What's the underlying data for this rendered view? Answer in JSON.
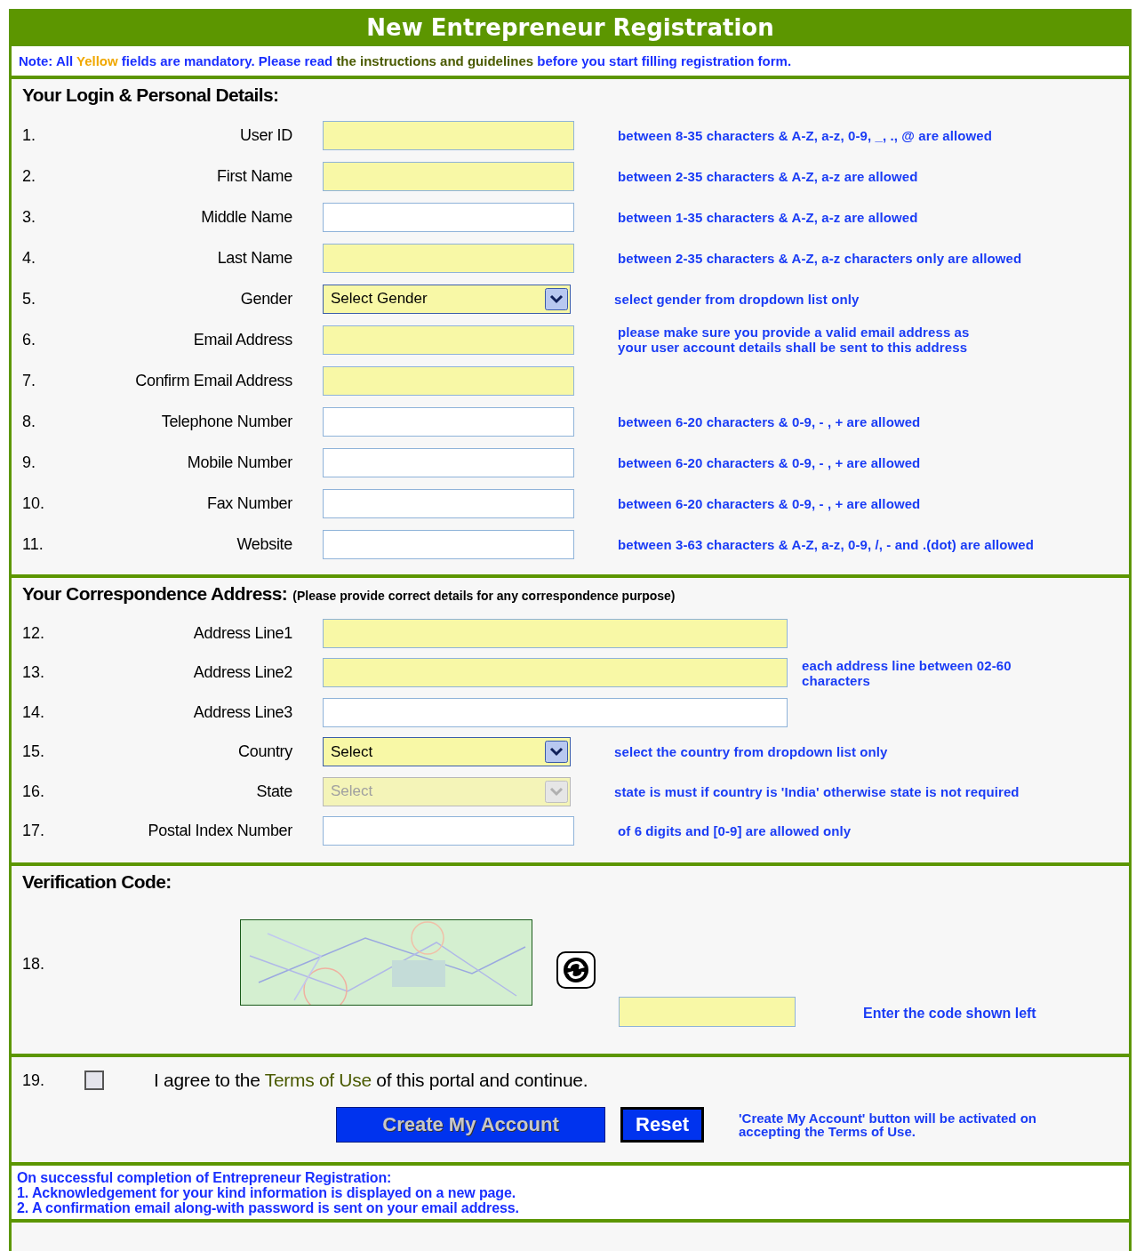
{
  "title": "New Entrepreneur Registration",
  "note": [
    {
      "kind": "plain",
      "text": "Note: All "
    },
    {
      "kind": "yellow",
      "text": "Yellow"
    },
    {
      "kind": "plain",
      "text": " fields are mandatory. Please read "
    },
    {
      "kind": "link",
      "text": "the instructions and guidelines"
    },
    {
      "kind": "plain",
      "text": " before you start filling registration form."
    }
  ],
  "personal": {
    "heading": "Your Login & Personal Details:",
    "rows": [
      {
        "number": "1.",
        "label": "User ID",
        "kind": "text",
        "required": true,
        "hint_lines": [
          "between 8-35 characters & A-Z, a-z, 0-9, _, ., @ are allowed"
        ]
      },
      {
        "number": "2.",
        "label": "First Name",
        "kind": "text",
        "required": true,
        "hint_lines": [
          "between 2-35 characters & A-Z, a-z are allowed"
        ]
      },
      {
        "number": "3.",
        "label": "Middle Name",
        "kind": "text",
        "required": false,
        "hint_lines": [
          "between 1-35 characters & A-Z, a-z are allowed"
        ]
      },
      {
        "number": "4.",
        "label": "Last Name",
        "kind": "text",
        "required": true,
        "hint_lines": [
          "between 2-35 characters & A-Z, a-z characters only are allowed"
        ]
      },
      {
        "number": "5.",
        "label": "Gender",
        "kind": "select",
        "required": true,
        "disabled": false,
        "value": "Select Gender",
        "hint_lines": [
          "select gender from dropdown list only"
        ]
      },
      {
        "number": "6.",
        "label": "Email Address",
        "kind": "text",
        "required": true,
        "hint_lines": [
          "please make sure you provide a valid email address as",
          "your user account details shall be sent to this address"
        ]
      },
      {
        "number": "7.",
        "label": "Confirm Email Address",
        "kind": "text",
        "required": true
      },
      {
        "number": "8.",
        "label": "Telephone Number",
        "kind": "text",
        "required": false,
        "hint_lines": [
          "between 6-20 characters & 0-9, - , +  are allowed"
        ]
      },
      {
        "number": "9.",
        "label": "Mobile Number",
        "kind": "text",
        "required": false,
        "hint_lines": [
          "between 6-20 characters & 0-9, - , +  are allowed"
        ]
      },
      {
        "number": "10.",
        "label": "Fax Number",
        "kind": "text",
        "required": false,
        "hint_lines": [
          "between 6-20 characters & 0-9, - , +  are allowed"
        ]
      },
      {
        "number": "11.",
        "label": "Website",
        "kind": "text",
        "required": false,
        "hint_lines": [
          "between 3-63 characters & A-Z, a-z, 0-9, /, - and .(dot) are allowed"
        ]
      }
    ]
  },
  "address": {
    "heading": "Your Correspondence Address:",
    "subheading": "(Please provide correct details for any correspondence purpose)",
    "rows": [
      {
        "number": "12.",
        "label": "Address Line1",
        "kind": "long_text",
        "required": true
      },
      {
        "number": "13.",
        "label": "Address Line2",
        "kind": "long_text",
        "required": true,
        "hint_lines": [
          "each address line between 02-60",
          "characters"
        ]
      },
      {
        "number": "14.",
        "label": "Address Line3",
        "kind": "long_text",
        "required": false
      },
      {
        "number": "15.",
        "label": "Country",
        "kind": "select",
        "required": true,
        "disabled": false,
        "value": "Select",
        "hint_lines": [
          "select the country from dropdown list only"
        ]
      },
      {
        "number": "16.",
        "label": "State",
        "kind": "select",
        "required": true,
        "disabled": true,
        "value": "Select",
        "hint_lines": [
          "state is must if country is 'India' otherwise state is not required"
        ]
      },
      {
        "number": "17.",
        "label": "Postal Index Number",
        "kind": "text",
        "required": false,
        "hint_lines": [
          "of 6 digits and [0-9] are allowed only"
        ]
      }
    ]
  },
  "verification": {
    "heading": "Verification Code:",
    "number": "18.",
    "hint": "Enter the code shown left"
  },
  "agreement": {
    "number": "19.",
    "checked": false,
    "text": [
      {
        "kind": "plain",
        "text": "I agree to the "
      },
      {
        "kind": "link",
        "text": "Terms of Use"
      },
      {
        "kind": "plain",
        "text": " of this portal and continue."
      }
    ],
    "buttons": [
      {
        "label": "Create My Account",
        "disabled": true
      },
      {
        "label": "Reset",
        "disabled": false
      }
    ],
    "note_lines": [
      "'Create My Account' button will be activated on",
      "accepting the Terms of Use."
    ]
  },
  "info_lines": [
    "On successful completion of Entrepreneur Registration:",
    "1. Acknowledgement for your kind information is displayed on a new page.",
    "2. A confirmation email along-with password is sent on your email address."
  ]
}
